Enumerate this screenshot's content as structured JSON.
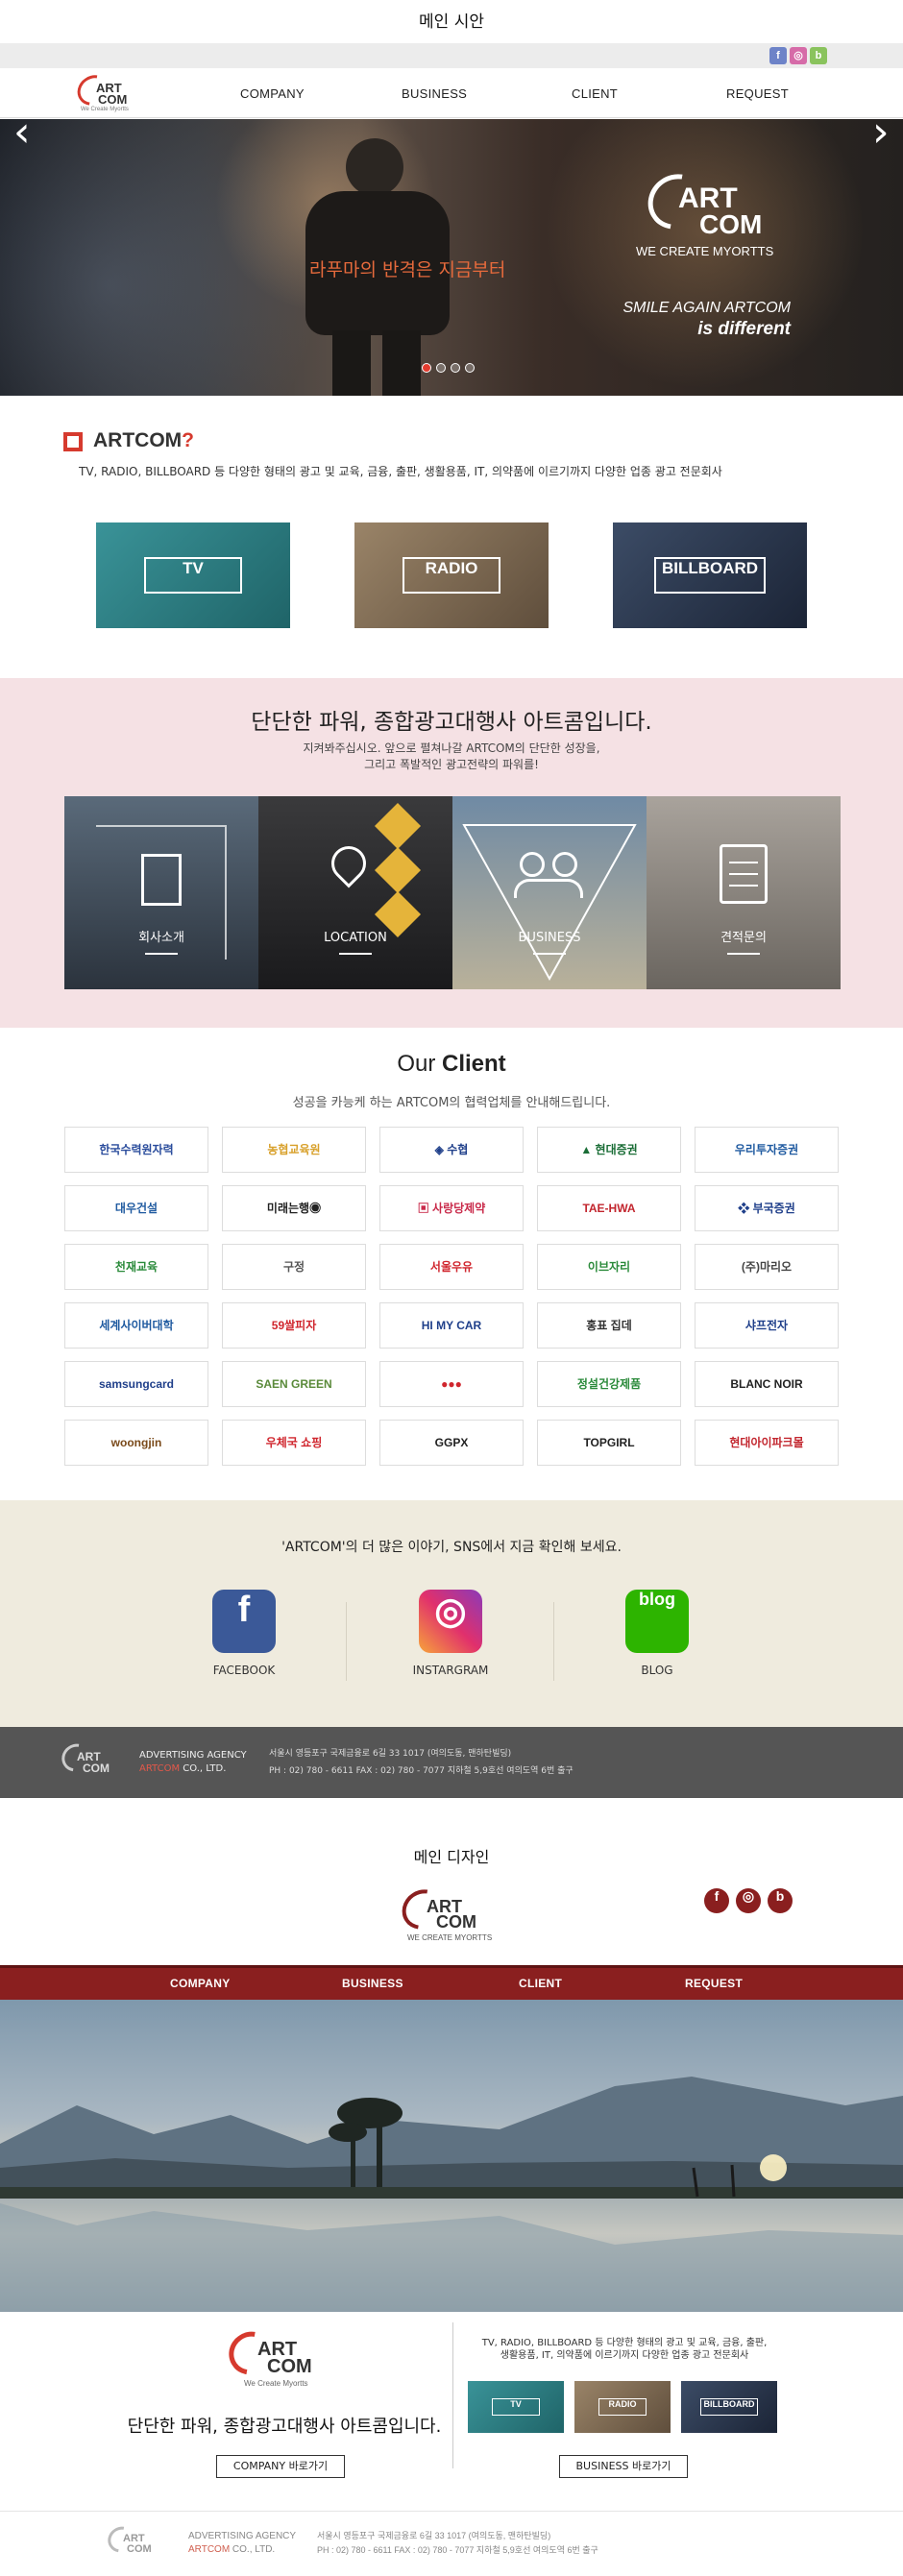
{
  "section1_title": "메인 시안",
  "sns_badges": [
    {
      "letter": "f",
      "color": "#6d83c8"
    },
    {
      "letter": "◎",
      "color": "#d66ba8"
    },
    {
      "letter": "b",
      "color": "#8ac35d"
    }
  ],
  "logo": {
    "art": "ART",
    "com": "COM",
    "tagline": "We Create Myortts"
  },
  "nav": [
    "COMPANY",
    "BUSINESS",
    "CLIENT",
    "REQUEST"
  ],
  "hero": {
    "left_arrow": "‹",
    "right_arrow": "›",
    "korean": "라푸마의 반격은 지금부터",
    "logo_art": "ART",
    "logo_com": "COM",
    "logo_tag": "WE CREATE MYORTTS",
    "slogan1": "SMILE AGAIN ARTCOM",
    "slogan2": "is different",
    "dots": [
      true,
      false,
      false,
      false
    ]
  },
  "intro": {
    "heading": "ARTCOM",
    "mark": "?",
    "desc": "TV, RADIO, BILLBOARD 등 다양한 형태의 광고 및 교육, 금융, 출판, 생활용품, IT, 의약품에 이르기까지 다양한 업종 광고 전문회사"
  },
  "categories": [
    {
      "label": "TV",
      "bg": "#2e7c80"
    },
    {
      "label": "RADIO",
      "bg": "#7b6852"
    },
    {
      "label": "BILLBOARD",
      "bg": "#28364a"
    }
  ],
  "power": {
    "title": "단단한 파워, 종합광고대행사 아트콤입니다.",
    "sub1": "지켜봐주십시오. 앞으로 펼쳐나갈 ARTCOM의 단단한 성장을,",
    "sub2": "그리고 폭발적인 광고전략의 파워를!"
  },
  "tiles": [
    {
      "label": "회사소개",
      "bg": "#3a4652",
      "icon": "building-icon"
    },
    {
      "label": "LOCATION",
      "bg": "#2a2b2d",
      "icon": "map-pin-icon"
    },
    {
      "label": "BUSINESS",
      "bg": "#7d92a6",
      "icon": "people-icon"
    },
    {
      "label": "견적문의",
      "bg": "#8a857f",
      "icon": "clipboard-icon"
    }
  ],
  "clients_section": {
    "title_light": "Our ",
    "title_bold": "Client",
    "sub": "성공을 카능케 하는 ARTCOM의 협력업체를 안내해드립니다."
  },
  "clients": [
    [
      {
        "t": "한국수력원자력",
        "c": "#2a4c9c"
      },
      {
        "t": "농협교육원",
        "c": "#d8a02a"
      },
      {
        "t": "◈ 수협",
        "c": "#1f3f8a"
      },
      {
        "t": "▲ 현대증권",
        "c": "#1a6d36"
      },
      {
        "t": "우리투자증권",
        "c": "#1f5aa0"
      }
    ],
    [
      {
        "t": "대우건설",
        "c": "#1f5aa0"
      },
      {
        "t": "미래는행◉",
        "c": "#222"
      },
      {
        "t": "▣ 사랑당제약",
        "c": "#c92a4a"
      },
      {
        "t": "TAE-HWA",
        "c": "#c2262e"
      },
      {
        "t": "❖ 부국증권",
        "c": "#1f3f8a"
      }
    ],
    [
      {
        "t": "천재교육",
        "c": "#2a8a3a"
      },
      {
        "t": "구정",
        "c": "#555"
      },
      {
        "t": "서울우유",
        "c": "#d0262e"
      },
      {
        "t": "이브자리",
        "c": "#2a8a3a"
      },
      {
        "t": "(주)마리오",
        "c": "#444"
      }
    ],
    [
      {
        "t": "세계사이버대학",
        "c": "#1f5aa0"
      },
      {
        "t": "59쌀피자",
        "c": "#d0262e"
      },
      {
        "t": "HI MY CAR",
        "c": "#1f3f8a"
      },
      {
        "t": "홍표 집데",
        "c": "#333"
      },
      {
        "t": "샤프전자",
        "c": "#1f3f8a"
      }
    ],
    [
      {
        "t": "samsungcard",
        "c": "#1f3f8a"
      },
      {
        "t": "SAEN GREEN",
        "c": "#5a8a3a"
      },
      {
        "t": "●●●",
        "c": "#d0262e"
      },
      {
        "t": "정설건강제품",
        "c": "#2a8a3a"
      },
      {
        "t": "BLANC NOIR",
        "c": "#222"
      }
    ],
    [
      {
        "t": "woongjin",
        "c": "#7a4a1a"
      },
      {
        "t": "우체국 쇼핑",
        "c": "#d0262e"
      },
      {
        "t": "GGPX",
        "c": "#222"
      },
      {
        "t": "TOPGIRL",
        "c": "#222"
      },
      {
        "t": "현대아이파크몰",
        "c": "#c2262e"
      }
    ]
  ],
  "sns_section": {
    "title": "'ARTCOM'의 더 많은 이야기, SNS에서 지금 확인해 보세요.",
    "items": [
      {
        "label": "FACEBOOK",
        "glyph": "f",
        "color": "#3b5998"
      },
      {
        "label": "INSTARGRAM",
        "glyph": "◎",
        "color": "#e1306c"
      },
      {
        "label": "BLOG",
        "glyph": "blog",
        "color": "#2db400"
      }
    ]
  },
  "footer": {
    "agency": "ADVERTISING AGENCY",
    "co_red": "ARTCOM",
    "co_rest": " CO., LTD.",
    "addr": "서울시 영등포구 국제금융로 6길 33 1017 (여의도동, 맨하탄빌딩)",
    "tel": "PH : 02) 780 - 6611 FAX : 02) 780 - 7077  지하철 5,9호선 여의도역 6번 출구"
  },
  "section2_title": "메인 디자인",
  "design": {
    "sns": [
      "f",
      "◎",
      "b"
    ],
    "nav": [
      "COMPANY",
      "BUSINESS",
      "CLIENT",
      "REQUEST"
    ],
    "power": "단단한 파워, 종합광고대행사 아트콤입니다.",
    "btn_company": "COMPANY 바로가기",
    "desc": "TV, RADIO, BILLBOARD 등 다양한 형태의 광고 및 교육, 금융, 출판, 생활용품, IT, 의약품에 이르기까지 다양한 업종 광고 전문회사",
    "btn_business": "BUSINESS 바로가기",
    "minis": [
      {
        "label": "TV",
        "bg": "#2e7c80"
      },
      {
        "label": "RADIO",
        "bg": "#7b6852"
      },
      {
        "label": "BILLBOARD",
        "bg": "#28364a"
      }
    ]
  }
}
